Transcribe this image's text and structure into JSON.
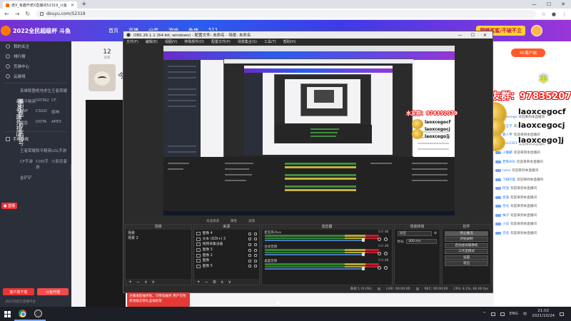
{
  "browser": {
    "tab_title": "老X_有趣开老X直播间52319_斗鱼",
    "url": "douyu.com/52319",
    "window_controls": [
      "—",
      "☐",
      "✕"
    ]
  },
  "douyu": {
    "logo_text": "2022全民超级杯 斗鱼",
    "nav": [
      "首页",
      "直播",
      "分类",
      "游戏",
      "鱼塘",
      "S11"
    ],
    "banner": "巅峰鲨鲨/不破不立",
    "sidebar": {
      "items": [
        "我的关注",
        "排行榜",
        "页游中心",
        "云游戏"
      ],
      "games": [
        "英雄联盟",
        "绝地求生",
        "王者荣耀",
        "和平精英",
        "DOTA2",
        "CF",
        "DNF",
        "CSGO",
        "原神",
        "魔兽",
        "DOTA",
        "APEX"
      ],
      "section2": "手机游戏",
      "mobile": [
        "王者荣耀",
        "和平精英",
        "LOL手游",
        "CF手游",
        "COD手游",
        "火影忍者",
        "金铲铲"
      ],
      "btn1": "客户端下载",
      "btn2": "斗鱼开播",
      "footer": "JN27的官方直播平台"
    },
    "streamer_vertical_1": "老X专属外挂店",
    "streamer_vertical_2": "兼职推广 专业配号",
    "watch_count": "12",
    "watch_label": "观看",
    "today": "今",
    "pc_button": "PC客户端",
    "big_mini": "丰",
    "chat_welcome": "欢迎来到本直播间",
    "chat_names": [
      "laoxcego",
      "小王子",
      "路人甲",
      "ws12301",
      "火麒麟",
      "老铁666",
      "nanx",
      "飞翔的鱼",
      "阿强",
      "星辰",
      "月光",
      "柚子",
      "小白",
      "无名"
    ],
    "notice": "主播发起抽奖啦，可参加抽奖 用户可免费领取实物礼品福利等"
  },
  "overlay": {
    "qq_line": "水友群：978352079",
    "chat_lines": [
      "laoxcegocf",
      "laoxcegocj",
      "laoxcego]j"
    ],
    "mini_qq_line": "水友群：978352079",
    "mini_chat_lines": [
      "laoxcegocf",
      "laoxcegocj",
      "laoxcego]j"
    ]
  },
  "obs": {
    "title": "OBS 26.1.1 (64-bit, windows) - 配置文件: 未命名 - 场景: 未命名",
    "menu": [
      "文件(F)",
      "编辑(E)",
      "视图(V)",
      "停靠部件(D)",
      "配置文件(P)",
      "场景集合(S)",
      "工具(T)",
      "帮助(H)"
    ],
    "toolbar": [
      "未选择源",
      "属性",
      "滤镜"
    ],
    "scenes": {
      "title": "场景",
      "items": [
        "场景",
        "场景 2"
      ]
    },
    "sources": {
      "title": "来源",
      "items": [
        "图像 4",
        "文本 (GDI+) 3",
        "视频采集设备",
        "图像 3",
        "图像 2",
        "图像",
        "图像 5"
      ]
    },
    "mixer": {
      "title": "混音器",
      "channels": [
        {
          "name": "麦克风/Aux",
          "db": "0.0 dB"
        },
        {
          "name": "台式音频",
          "db": "0.0 dB"
        },
        {
          "name": "桌面音频",
          "db": "0.0 dB"
        }
      ]
    },
    "transitions": {
      "title": "场景转场",
      "type": "淡出",
      "duration_label": "时长",
      "duration": "300 ms"
    },
    "controls": {
      "title": "控件",
      "buttons": [
        "停止推流",
        "开始录制",
        "启动虚拟摄像机",
        "工作室模式",
        "设置",
        "退出"
      ]
    },
    "status": {
      "dropped": "丢帧 1 (0.0%)",
      "live": "LIVE: 00:00:00",
      "rec": "REC: 00:00:00",
      "cpu": "CPU: 4.1%, 60.00 fps"
    },
    "dock_buttons": [
      "+",
      "−",
      "∧",
      "∨"
    ]
  },
  "taskbar": {
    "tray": [
      "^",
      "ENG",
      "中"
    ],
    "time": "21:02",
    "date": "2021/10/24"
  }
}
